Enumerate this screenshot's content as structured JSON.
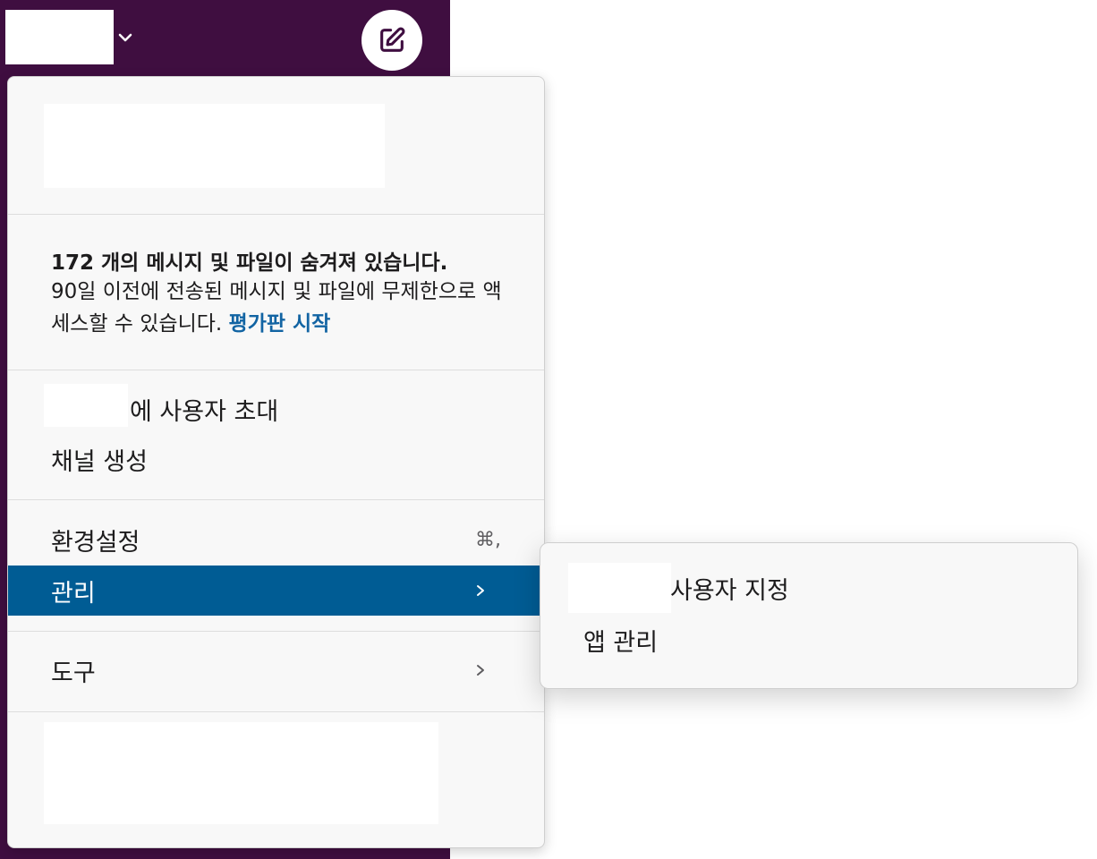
{
  "colors": {
    "sidebar": "#3f0e40",
    "menu_bg": "#f8f8f8",
    "active_item": "#005c94",
    "link": "#1264a3"
  },
  "header": {
    "workspace_chevron_icon": "chevron-down-icon",
    "compose_icon": "compose-icon"
  },
  "notice": {
    "title": "172 개의 메시지 및 파일이 숨겨져 있습니다.",
    "body": "90일 이전에 전송된 메시지 및 파일에 무제한으로 액세스할 수 있습니다.",
    "link": "평가판 시작"
  },
  "menu": {
    "invite_suffix": "에 사용자 초대",
    "create_channel": "채널 생성",
    "preferences": "환경설정",
    "preferences_shortcut": "⌘,",
    "admin": "관리",
    "tools": "도구"
  },
  "submenu": {
    "customize_suffix": "사용자 지정",
    "manage_apps": "앱 관리"
  }
}
